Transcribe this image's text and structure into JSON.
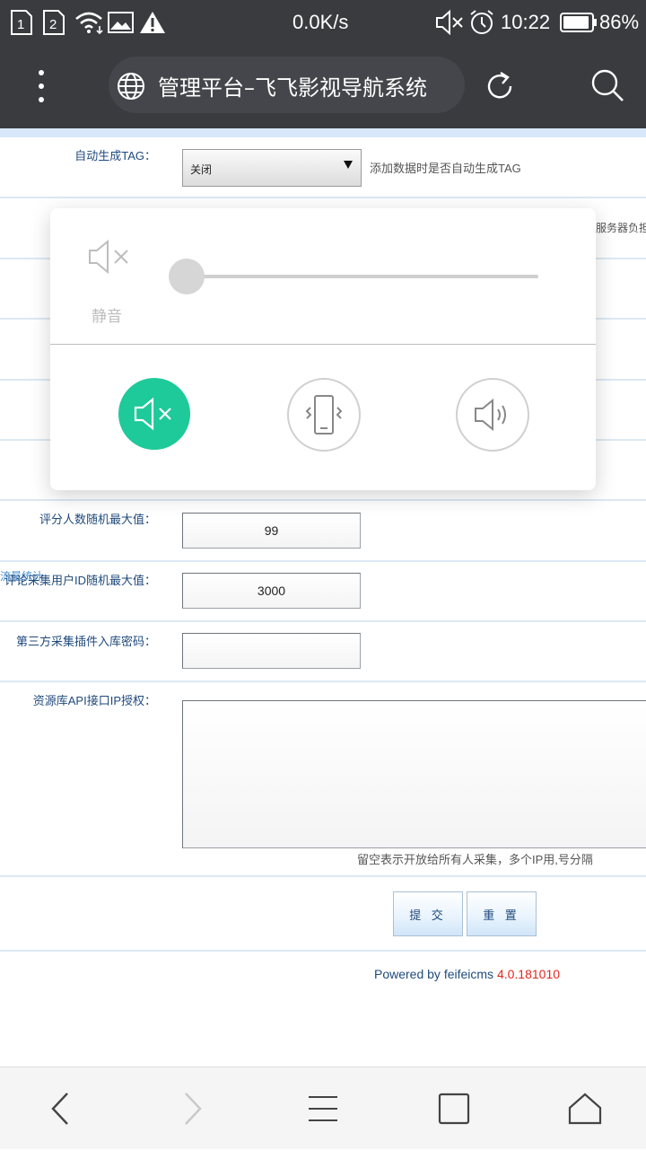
{
  "status_bar": {
    "sim1": "1",
    "sim2": "2",
    "network_speed": "0.0K/s",
    "time": "10:22",
    "battery": "86%",
    "icons": [
      "sim1-icon",
      "sim2-icon",
      "wifi-icon",
      "image-icon",
      "warning-icon",
      "mute-icon",
      "alarm-icon",
      "battery-icon"
    ]
  },
  "browser": {
    "title": "管理平台–飞飞影视导航系统",
    "icons": [
      "menu-dots-icon",
      "globe-icon",
      "refresh-icon",
      "search-icon"
    ]
  },
  "form": {
    "auto_tag": {
      "label": "自动生成TAG：",
      "value": "关闭",
      "hint": "添加数据时是否自动生成TAG"
    },
    "partial_hint": "服务器负担",
    "rating_max": {
      "label": "评分人数随机最大值：",
      "value": "99"
    },
    "comment_uid_max": {
      "label": "评论采集用户ID随机最大值：",
      "value": "3000",
      "overlap_text": "流量统计"
    },
    "plugin_password": {
      "label": "第三方采集插件入库密码：",
      "value": ""
    },
    "api_ip": {
      "label": "资源库API接口IP授权：",
      "value": "",
      "hint": "留空表示开放给所有人采集，多个IP用,号分隔"
    },
    "submit_label": "提 交",
    "reset_label": "重 置"
  },
  "footer": {
    "powered_by": "Powered by feifeicms",
    "version": "4.0.181010"
  },
  "volume_panel": {
    "mute_label": "静音",
    "slider_value": 0,
    "modes": [
      "mute",
      "vibrate",
      "sound"
    ],
    "active_mode": "mute",
    "accent": "#1ec99a"
  },
  "nav_bar": {
    "icons": [
      "back-icon",
      "forward-icon",
      "menu-icon",
      "tabs-icon",
      "home-icon"
    ]
  }
}
